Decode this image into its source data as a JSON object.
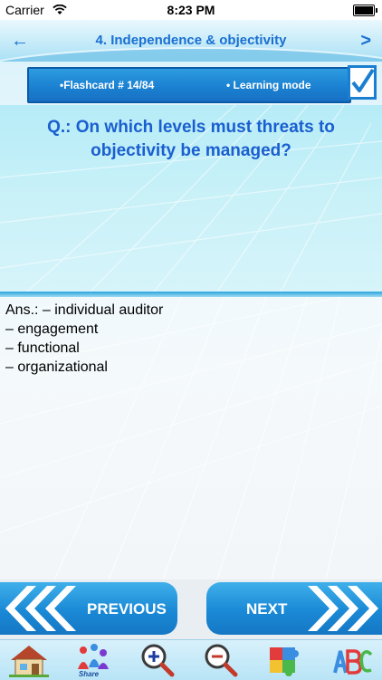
{
  "status_bar": {
    "carrier": "Carrier",
    "time": "8:23 PM"
  },
  "header": {
    "title": "4. Independence & objectivity",
    "back_arrow": "←",
    "forward_arrow": ">"
  },
  "info_bar": {
    "flashcard": "•Flashcard #  14/84",
    "mode": "• Learning mode"
  },
  "question": "Q.: On which levels must threats to objectivity be managed?",
  "answer": "Ans.:   – individual auditor\n– engagement\n– functional\n– organizational",
  "navigation": {
    "previous_label": "PREVIOUS",
    "next_label": "NEXT"
  },
  "toolbar": {
    "share_label": "Share",
    "icons": [
      "home-icon",
      "share-icon",
      "zoom-in-icon",
      "zoom-out-icon",
      "puzzle-icon",
      "abc-blocks-icon"
    ]
  },
  "colors": {
    "accent": "#1a7fd0",
    "question_text": "#1a5fd0",
    "title_text": "#1a6fd1"
  }
}
